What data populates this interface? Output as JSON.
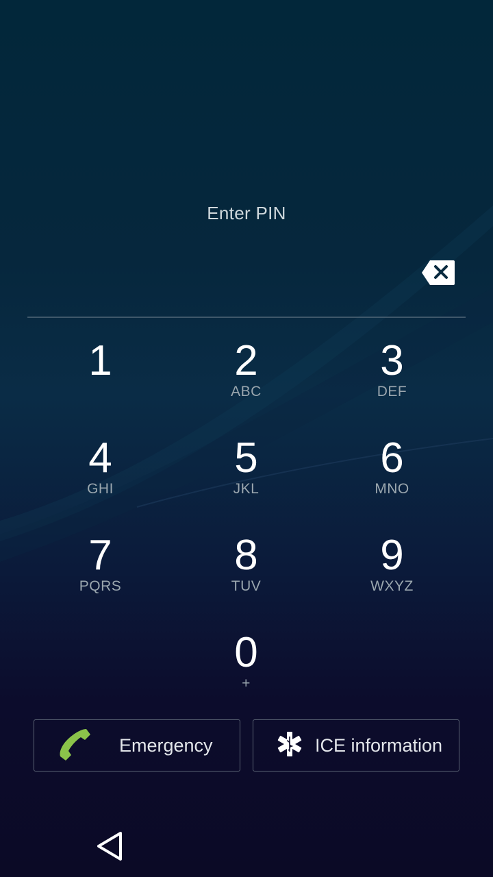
{
  "header": {
    "title": "Enter PIN"
  },
  "icons": {
    "backspace": "backspace-icon",
    "emergency": "phone-icon",
    "ice": "star-of-life-icon",
    "back": "back-triangle-icon"
  },
  "keypad": {
    "keys": [
      {
        "digit": "1",
        "letters": ""
      },
      {
        "digit": "2",
        "letters": "ABC"
      },
      {
        "digit": "3",
        "letters": "DEF"
      },
      {
        "digit": "4",
        "letters": "GHI"
      },
      {
        "digit": "5",
        "letters": "JKL"
      },
      {
        "digit": "6",
        "letters": "MNO"
      },
      {
        "digit": "7",
        "letters": "PQRS"
      },
      {
        "digit": "8",
        "letters": "TUV"
      },
      {
        "digit": "9",
        "letters": "WXYZ"
      },
      {
        "digit": "0",
        "letters": "+"
      }
    ]
  },
  "actions": {
    "emergency_label": "Emergency",
    "ice_label": "ICE information"
  },
  "colors": {
    "phone_icon": "#8bc34a",
    "text": "#ffffff",
    "subtext": "#9aa6ae"
  }
}
